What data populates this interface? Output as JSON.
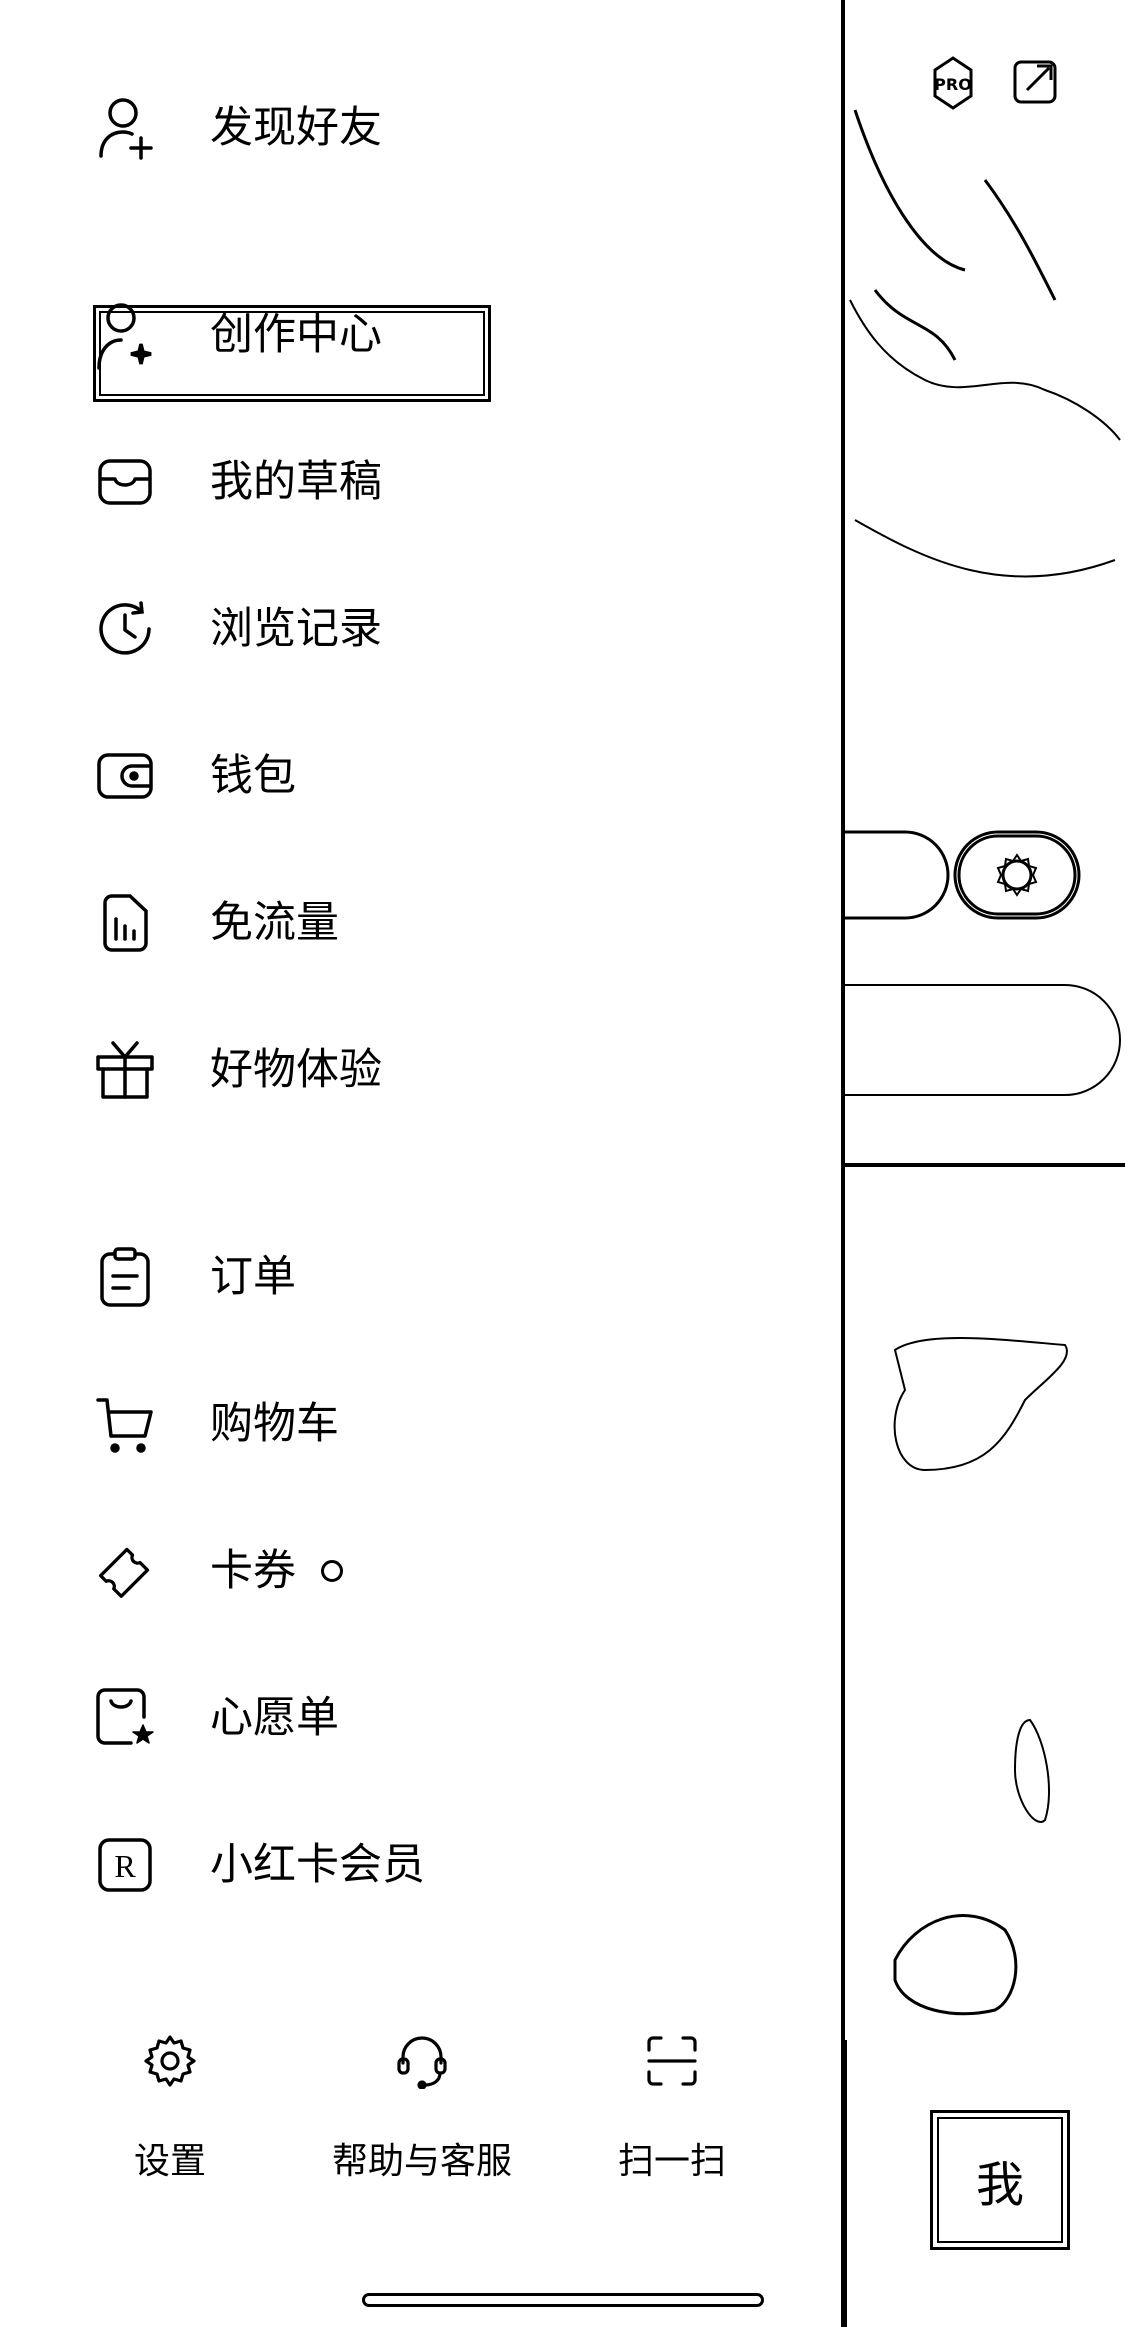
{
  "drawer": {
    "items": [
      {
        "label": "发现好友",
        "icon": "add-user-icon"
      },
      {
        "label": "创作中心",
        "icon": "creator-center-icon"
      },
      {
        "label": "我的草稿",
        "icon": "draft-box-icon"
      },
      {
        "label": "浏览记录",
        "icon": "history-icon"
      },
      {
        "label": "钱包",
        "icon": "wallet-icon"
      },
      {
        "label": "免流量",
        "icon": "data-free-icon"
      },
      {
        "label": "好物体验",
        "icon": "gift-icon"
      },
      {
        "label": "订单",
        "icon": "order-icon"
      },
      {
        "label": "购物车",
        "icon": "cart-icon"
      },
      {
        "label": "卡券",
        "icon": "coupon-icon"
      },
      {
        "label": "心愿单",
        "icon": "wishlist-icon"
      },
      {
        "label": "小红卡会员",
        "icon": "membership-icon"
      }
    ]
  },
  "bottom_actions": [
    {
      "label": "设置",
      "icon": "gear-icon"
    },
    {
      "label": "帮助与客服",
      "icon": "headset-icon"
    },
    {
      "label": "扫一扫",
      "icon": "scan-icon"
    }
  ],
  "background_page": {
    "badge": "PRO",
    "tab_me": "我"
  }
}
